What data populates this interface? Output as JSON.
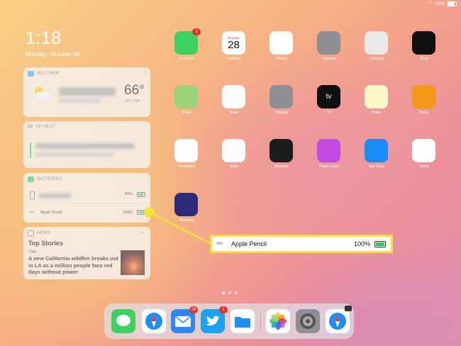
{
  "status_bar": {
    "battery_pct": "85%"
  },
  "lock": {
    "time": "1:18",
    "date": "Monday, October 28"
  },
  "widgets": {
    "weather": {
      "header": "WEATHER",
      "temp": "66°",
      "hilo": "87° / 68°"
    },
    "up_next": {
      "date_num": "28",
      "header": "UP NEXT"
    },
    "batteries": {
      "header": "BATTERIES",
      "device_pct": "85%",
      "pencil_label": "Apple Pencil",
      "pencil_pct": "100%",
      "device_level": 0.85,
      "pencil_level": 1.0
    },
    "news": {
      "header": "NEWS",
      "title": "Top Stories",
      "source": "CNN",
      "headline": "A new California wildfire breaks out in LA as a million people face red days without power"
    }
  },
  "apps": [
    {
      "label": "FaceTime",
      "color": "#3fd063",
      "badge": "1"
    },
    {
      "label": "Calendar",
      "color": "#ffffff",
      "month": "Monday",
      "day": "28"
    },
    {
      "label": "Photos",
      "color": "#ffffff"
    },
    {
      "label": "Camera",
      "color": "#8e8e93"
    },
    {
      "label": "Contacts",
      "color": "#e9e9ea"
    },
    {
      "label": "Clock",
      "color": "#111111"
    },
    {
      "label": "Maps",
      "color": "#9bd27a"
    },
    {
      "label": "Music",
      "color": "#fbfbfb"
    },
    {
      "label": "Settings",
      "color": "#8e8e93"
    },
    {
      "label": "TV",
      "color": "#111111",
      "glyph": "tv"
    },
    {
      "label": "Notes",
      "color": "#fdf6c8"
    },
    {
      "label": "Books",
      "color": "#f39a1a"
    },
    {
      "label": "Reminders",
      "color": "#ffffff"
    },
    {
      "label": "News",
      "color": "#fbfbfb"
    },
    {
      "label": "Measure",
      "color": "#1c1c1e"
    },
    {
      "label": "iTunes Store",
      "color": "#c24ae0"
    },
    {
      "label": "App Store",
      "color": "#1b8cf5"
    },
    {
      "label": "Home",
      "color": "#ffffff"
    },
    {
      "label": "Shortcuts",
      "color": "#2e2a7a"
    }
  ],
  "dock": {
    "messages_color": "#3fd063",
    "mail_badge": "29",
    "twitter_badge": "1"
  },
  "callout": {
    "label": "Apple Pencil",
    "pct": "100%"
  },
  "colors": {
    "highlight": "#f4e23c",
    "battery_green": "#34c759"
  }
}
